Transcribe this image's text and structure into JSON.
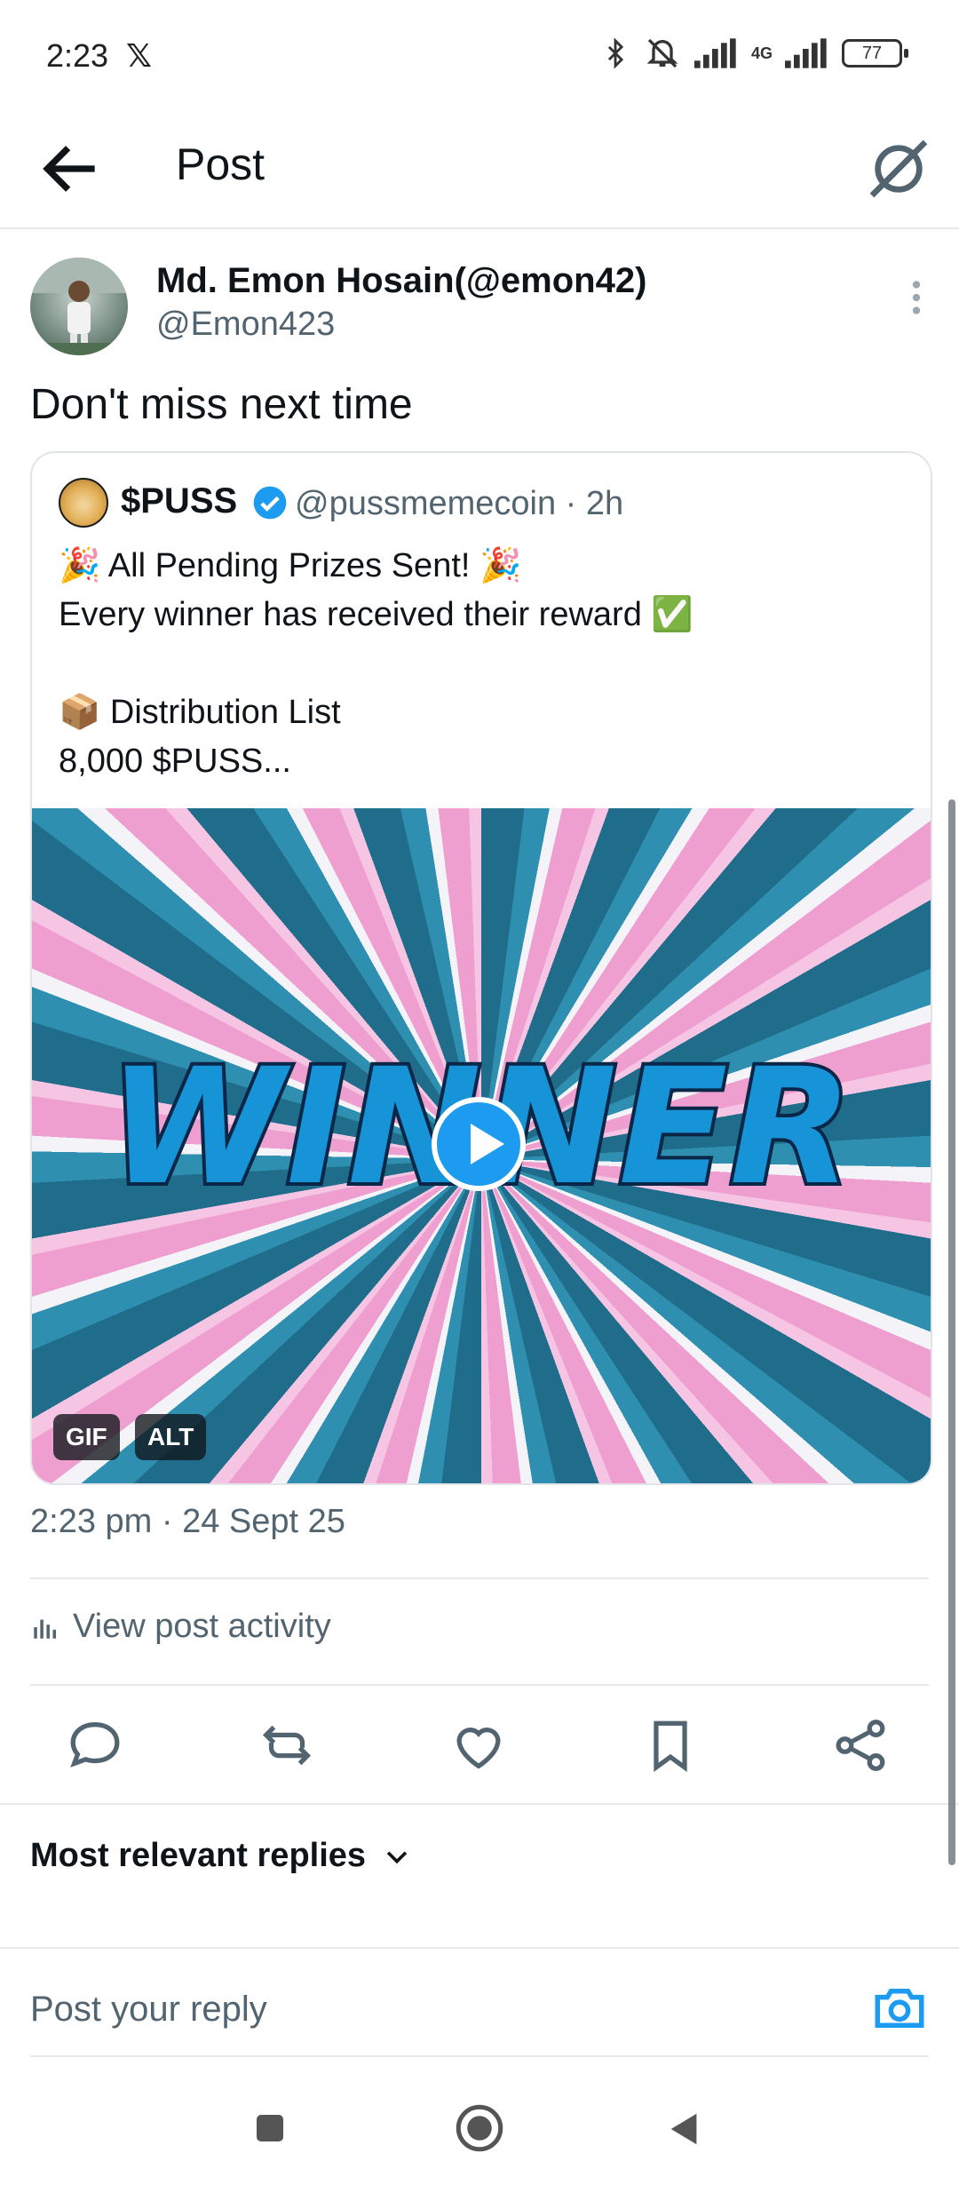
{
  "status_bar": {
    "time": "2:23",
    "x_glyph": "𝕏",
    "network": "4G",
    "battery": "77"
  },
  "header": {
    "title": "Post"
  },
  "post": {
    "author_name": "Md. Emon Hosain(@emon42)",
    "author_handle": "@Emon423",
    "text": "Don't miss next time",
    "timestamp": "2:23 pm · 24 Sept 25",
    "activity_label": "View post activity"
  },
  "quoted": {
    "name": "$PUSS",
    "handle": "@pussmemecoin · 2h",
    "text": "🎉 All Pending Prizes Sent! 🎉\nEvery winner has received their reward ✅\n\n📦 Distribution List\n8,000 $PUSS...",
    "media_text": "WINNER",
    "badge_gif": "GIF",
    "badge_alt": "ALT"
  },
  "replies": {
    "sort_label": "Most relevant replies",
    "input_placeholder": "Post your reply"
  },
  "colors": {
    "accent": "#1d9bf0",
    "secondary_text": "#536471",
    "primary_text": "#0f1419"
  }
}
